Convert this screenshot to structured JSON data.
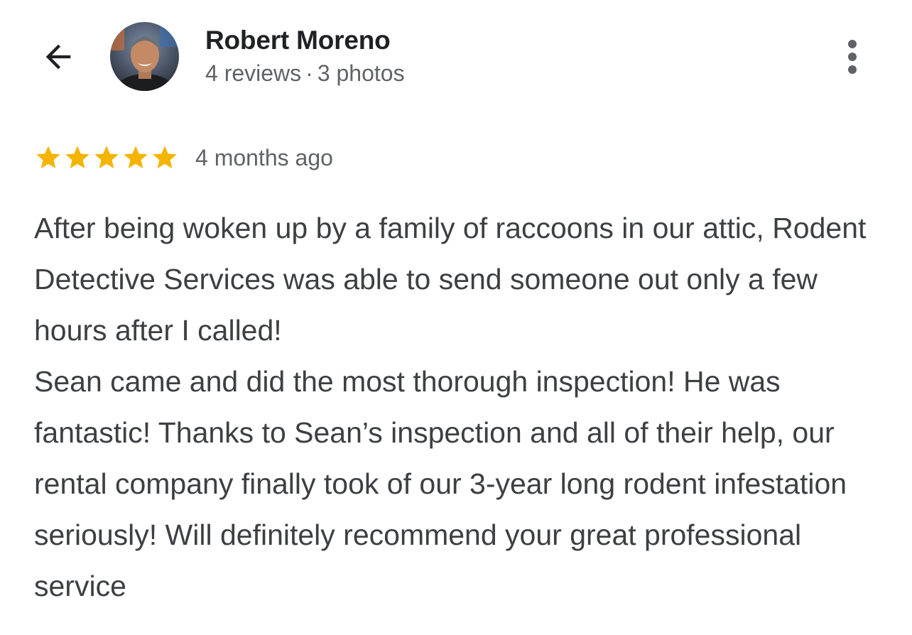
{
  "reviewer": {
    "name": "Robert Moreno",
    "reviews_count": "4 reviews",
    "separator": "·",
    "photos_count": "3 photos"
  },
  "review": {
    "rating": 5,
    "rating_max": 5,
    "date": "4 months ago",
    "paragraphs": [
      "After being woken up by a family of raccoons in our attic, Rodent Detective Services was able to send someone out only a few hours after I called!",
      "Sean came and did the most thorough inspection! He was fantastic! Thanks to Sean’s inspection and all of their help, our rental company finally took of our 3-year long rodent infestation seriously! Will definitely recommend your great professional service"
    ]
  },
  "colors": {
    "star": "#f4b400",
    "icon": "#5f6368",
    "name": "#202124",
    "meta": "#5f6368",
    "body": "#3c4043"
  },
  "icons": {
    "back": "arrow-back-icon",
    "more": "more-vert-icon",
    "star": "star-icon"
  }
}
